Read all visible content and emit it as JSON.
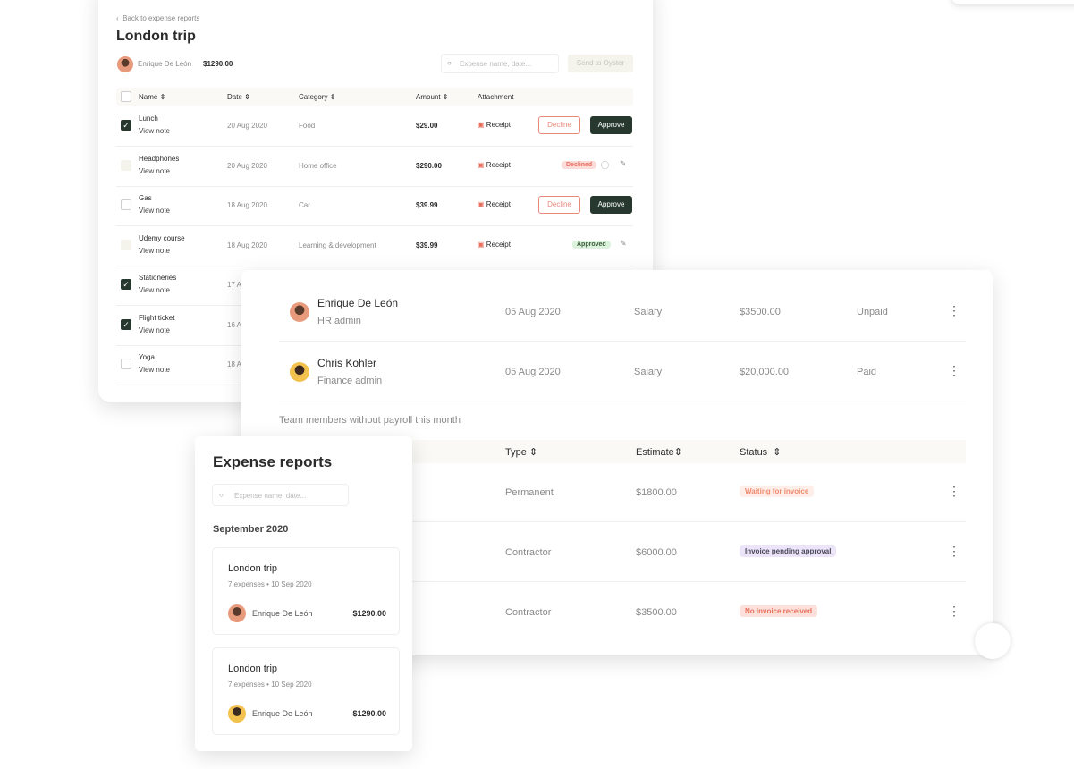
{
  "expense_detail": {
    "back_label": "Back to expense reports",
    "title": "London trip",
    "employee": "Enrique De León",
    "total": "$1290.00",
    "search_placeholder": "Expense name, date...",
    "send_label": "Send to Oyster",
    "columns": [
      "Name",
      "Date",
      "Category",
      "Amount",
      "Attachment"
    ],
    "view_note": "View note",
    "receipt": "Receipt",
    "decline": "Decline",
    "approve": "Approve",
    "rows": [
      {
        "name": "Lunch",
        "date": "20 Aug 2020",
        "category": "Food",
        "amount": "$29.00",
        "state": "pending",
        "checked": true
      },
      {
        "name": "Headphones",
        "date": "20 Aug 2020",
        "category": "Home office",
        "amount": "$290.00",
        "state": "Declined",
        "checked": false
      },
      {
        "name": "Gas",
        "date": "18 Aug 2020",
        "category": "Car",
        "amount": "$39.99",
        "state": "pending",
        "checked": false
      },
      {
        "name": "Udemy course",
        "date": "18 Aug 2020",
        "category": "Learning & development",
        "amount": "$39.99",
        "state": "Approved",
        "checked": false
      },
      {
        "name": "Stationeries",
        "date": "17 A",
        "checked": true
      },
      {
        "name": "Flight ticket",
        "date": "16 A",
        "checked": true
      },
      {
        "name": "Yoga",
        "date": "18 A",
        "checked": false
      }
    ]
  },
  "payroll": {
    "people": [
      {
        "name": "Enrique De León",
        "role": "HR admin",
        "date": "05 Aug 2020",
        "type": "Salary",
        "amount": "$3500.00",
        "status": "Unpaid"
      },
      {
        "name": "Chris Kohler",
        "role": "Finance admin",
        "date": "05 Aug 2020",
        "type": "Salary",
        "amount": "$20,000.00",
        "status": "Paid"
      }
    ],
    "section_title": "Team members without payroll this month",
    "columns": [
      "Type",
      "Estimate",
      "Status"
    ],
    "rows": [
      {
        "type": "Permanent",
        "estimate": "$1800.00",
        "status": "Waiting for invoice",
        "color": "#f08a6e",
        "bg": "#fdeee9"
      },
      {
        "type": "Contractor",
        "estimate": "$6000.00",
        "status": "Invoice pending approval",
        "color": "#4a4a5a",
        "bg": "#ece4f8"
      },
      {
        "type": "Contractor",
        "estimate": "$3500.00",
        "status": "No invoice received",
        "color": "#e8705e",
        "bg": "#fbe0dc"
      }
    ]
  },
  "reports": {
    "title": "Expense reports",
    "search_placeholder": "Expense name, date...",
    "month": "September 2020",
    "items": [
      {
        "title": "London trip",
        "meta": "7 expenses • 10 Sep 2020",
        "employee": "Enrique De León",
        "amount": "$1290.00"
      },
      {
        "title": "London trip",
        "meta": "7 expenses • 10 Sep 2020",
        "employee": "Enrique De León",
        "amount": "$1290.00"
      }
    ]
  }
}
